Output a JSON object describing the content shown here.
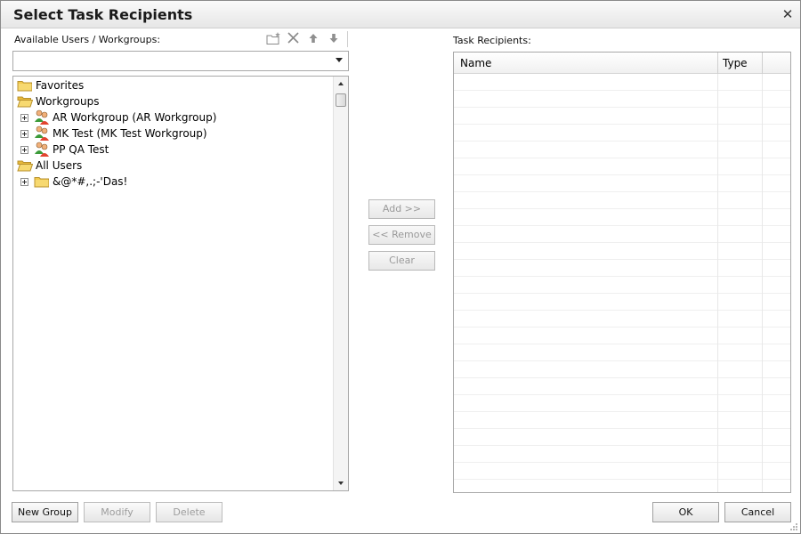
{
  "dialog": {
    "title": "Select Task Recipients",
    "close_glyph": "✕"
  },
  "left": {
    "label": "Available Users / Workgroups:",
    "toolbar": [
      "new-folder-icon",
      "delete-icon",
      "move-up-icon",
      "move-down-icon"
    ],
    "combo_value": "",
    "tree": [
      {
        "label": "Favorites",
        "icon": "folder-icon",
        "expander": false
      },
      {
        "label": "Workgroups",
        "icon": "folder-open-icon",
        "expander": false
      },
      {
        "label": "AR Workgroup (AR Workgroup)",
        "icon": "workgroup-icon",
        "expander": true
      },
      {
        "label": "MK Test (MK Test Workgroup)",
        "icon": "workgroup-icon",
        "expander": true
      },
      {
        "label": "PP QA Test",
        "icon": "workgroup-icon",
        "expander": true
      },
      {
        "label": "All Users",
        "icon": "folder-open-icon",
        "expander": false
      },
      {
        "label": "&@*#,.;-'Das!",
        "icon": "folder-icon",
        "expander": true
      }
    ]
  },
  "middle": {
    "add": "Add >>",
    "remove": "<< Remove",
    "clear": "Clear"
  },
  "right": {
    "label": "Task Recipients:",
    "columns": {
      "name": "Name",
      "type": "Type"
    },
    "rows": []
  },
  "footer": {
    "new_group": "New Group",
    "modify": "Modify",
    "delete": "Delete",
    "ok": "OK",
    "cancel": "Cancel"
  },
  "colors": {
    "folder": "#f2c94c",
    "group_member_a": "#e2442f",
    "group_member_b": "#3c9b3a"
  }
}
